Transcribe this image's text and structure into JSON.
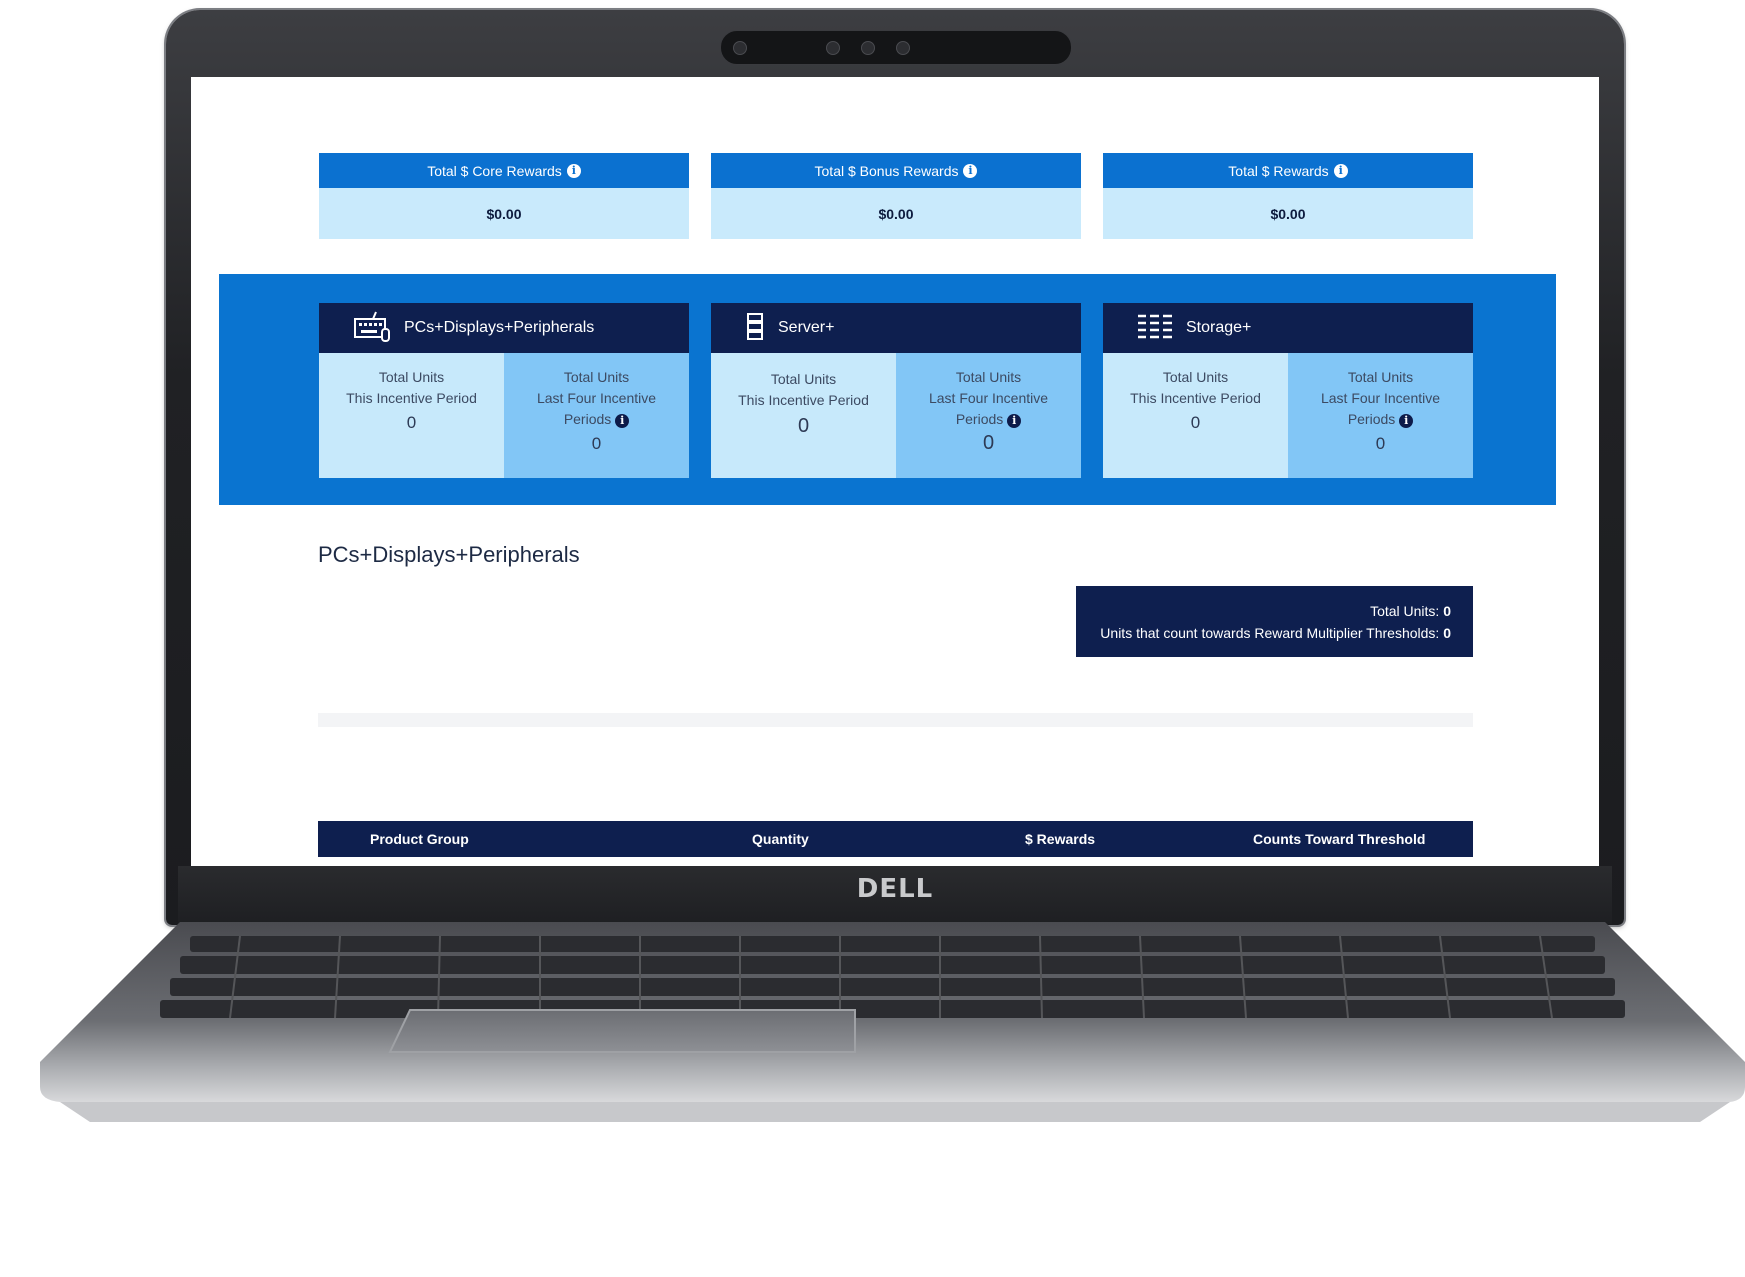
{
  "device": {
    "brand": "DELL"
  },
  "rewards": [
    {
      "label": "Total $ Core Rewards",
      "value": "$0.00",
      "icon": "info-icon"
    },
    {
      "label": "Total $ Bonus Rewards",
      "value": "$0.00",
      "icon": "info-icon"
    },
    {
      "label": "Total $ Rewards",
      "value": "$0.00",
      "icon": "info-icon"
    }
  ],
  "categories": [
    {
      "title": "PCs+Displays+Peripherals",
      "icon": "keyboard-icon",
      "current": {
        "line1": "Total Units",
        "line2": "This Incentive Period",
        "value": "0"
      },
      "last_four": {
        "line1": "Total Units",
        "line2": "Last Four Incentive",
        "line3": "Periods",
        "value": "0"
      }
    },
    {
      "title": "Server+",
      "icon": "server-icon",
      "current": {
        "line1": "Total Units",
        "line2": "This Incentive Period",
        "value": "0"
      },
      "last_four": {
        "line1": "Total Units",
        "line2": "Last Four Incentive",
        "line3": "Periods",
        "value": "0"
      }
    },
    {
      "title": "Storage+",
      "icon": "storage-icon",
      "current": {
        "line1": "Total Units",
        "line2": "This Incentive Period",
        "value": "0"
      },
      "last_four": {
        "line1": "Total Units",
        "line2": "Last Four Incentive",
        "line3": "Periods",
        "value": "0"
      }
    }
  ],
  "section": {
    "title": "PCs+Displays+Peripherals",
    "total_units_label": "Total Units:",
    "total_units_value": "0",
    "threshold_label": "Units that count towards Reward Multiplier Thresholds:",
    "threshold_value": "0"
  },
  "table": {
    "columns": [
      "Product Group",
      "Quantity",
      "$ Rewards",
      "Counts Toward Threshold"
    ]
  },
  "colors": {
    "primary_blue": "#0a74d0",
    "navy": "#0e1f4f",
    "light_blue": "#c7e9fb",
    "mid_blue": "#82c6f6"
  }
}
